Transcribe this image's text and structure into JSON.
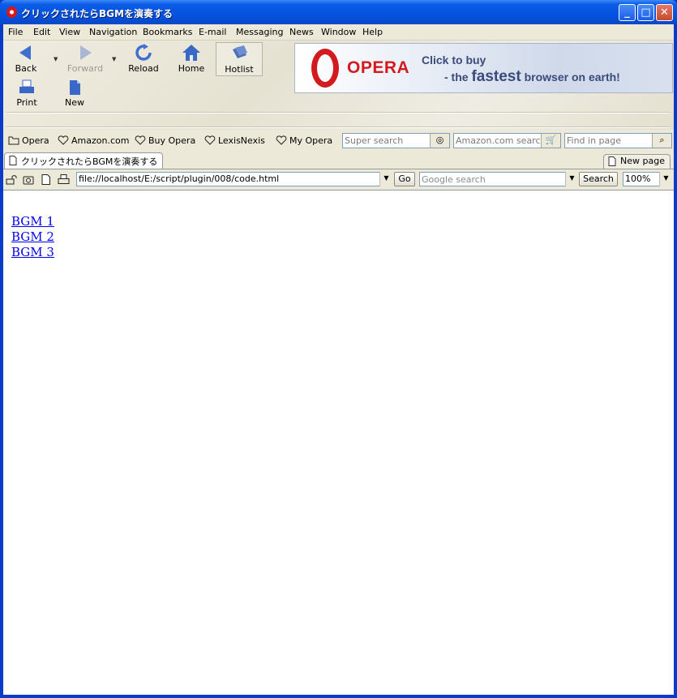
{
  "window": {
    "title": "クリックされたらBGMを演奏する",
    "controls": {
      "minimize": "_",
      "maximize": "□",
      "close": "✕"
    }
  },
  "menubar": {
    "items": [
      "File",
      "Edit",
      "View",
      "Navigation",
      "Bookmarks",
      "E-mail",
      "Messaging",
      "News",
      "Window",
      "Help"
    ]
  },
  "toolbar": {
    "back": "Back",
    "forward": "Forward",
    "reload": "Reload",
    "home": "Home",
    "hotlist": "Hotlist",
    "print": "Print",
    "new": "New"
  },
  "banner": {
    "brand": "OPERA",
    "line1": "Click to buy",
    "line2_prefix": "- the",
    "line2_emphasis": "fastest",
    "line2_suffix": "browser on earth!"
  },
  "personal_bar": {
    "items": [
      "Opera",
      "Amazon.com",
      "Buy Opera",
      "LexisNexis",
      "My Opera"
    ],
    "super_search_placeholder": "Super search",
    "amazon_search_placeholder": "Amazon.com search",
    "find_placeholder": "Find in page"
  },
  "tabs": {
    "active": "クリックされたらBGMを演奏する",
    "new_page": "New page"
  },
  "address_bar": {
    "url": "file://localhost/E:/script/plugin/008/code.html",
    "go": "Go",
    "search_placeholder": "Google search",
    "search_button": "Search",
    "zoom": "100%"
  },
  "page": {
    "links": [
      "BGM 1",
      "BGM 2",
      "BGM 3"
    ]
  },
  "colors": {
    "titlebar": "#0553e0",
    "chrome": "#ece9d8",
    "link": "#0000ee",
    "brand_red": "#d21a1f"
  },
  "icons": {
    "app": "opera-logo-icon",
    "back": "back-arrow-icon",
    "forward": "forward-arrow-icon",
    "reload": "reload-icon",
    "home": "home-icon",
    "hotlist": "hotlist-icon",
    "print": "printer-icon",
    "new": "new-page-icon"
  }
}
